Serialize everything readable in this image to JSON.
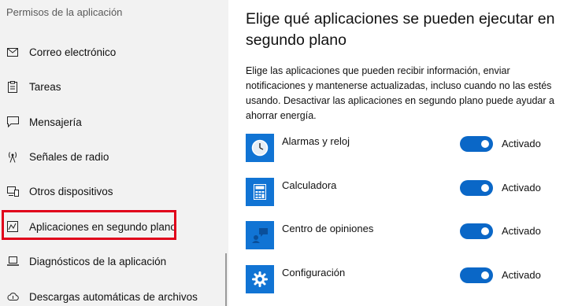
{
  "sidebar": {
    "header": "Permisos de la aplicación",
    "items": [
      {
        "label": "Correo electrónico",
        "icon": "mail-icon"
      },
      {
        "label": "Tareas",
        "icon": "clipboard-icon"
      },
      {
        "label": "Mensajería",
        "icon": "chat-icon"
      },
      {
        "label": "Señales de radio",
        "icon": "antenna-icon"
      },
      {
        "label": "Otros dispositivos",
        "icon": "devices-icon"
      },
      {
        "label": "Aplicaciones en segundo plano",
        "icon": "background-apps-icon",
        "selected": true
      },
      {
        "label": "Diagnósticos de la aplicación",
        "icon": "laptop-icon"
      },
      {
        "label": "Descargas automáticas de archivos",
        "icon": "cloud-download-icon"
      }
    ]
  },
  "main": {
    "title": "Elige qué aplicaciones se pueden ejecutar en segundo plano",
    "description": "Elige las aplicaciones que pueden recibir información, enviar notificaciones y mantenerse actualizadas, incluso cuando no las estés usando. Desactivar las aplicaciones en segundo plano puede ayudar a ahorrar energía.",
    "apps": [
      {
        "name": "Alarmas y reloj",
        "icon": "clock-icon",
        "state": "Activado",
        "on": true
      },
      {
        "name": "Calculadora",
        "icon": "calculator-icon",
        "state": "Activado",
        "on": true
      },
      {
        "name": "Centro de opiniones",
        "icon": "feedback-icon",
        "state": "Activado",
        "on": true
      },
      {
        "name": "Configuración",
        "icon": "gear-icon",
        "state": "Activado",
        "on": true
      }
    ]
  },
  "colors": {
    "accent": "#0a67c7",
    "tile": "#1174d4",
    "highlight": "#e0001b",
    "sidebar_bg": "#f2f2f2"
  }
}
